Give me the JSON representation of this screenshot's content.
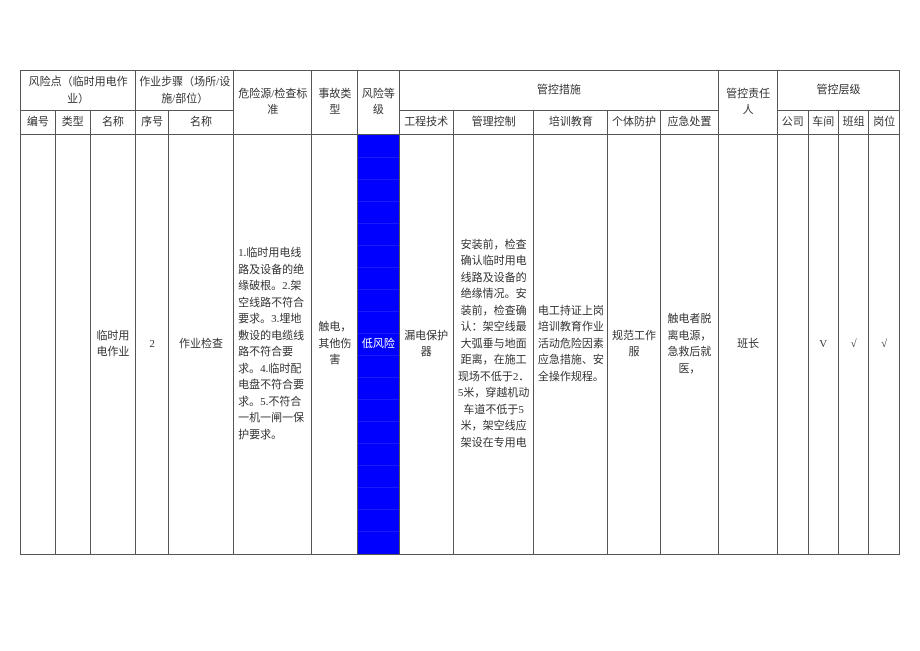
{
  "header": {
    "risk_point": "风险点（临时用电作业）",
    "work_step": "作业步骤（场所/设施/部位）",
    "hazard_source": "危险源/检查标准",
    "accident_type": "事故类型",
    "risk_level": "风险等级",
    "control_measures": "管控措施",
    "control_person": "管控责任人",
    "control_tier": "管控层级",
    "no": "编号",
    "type": "类型",
    "name": "名称",
    "seq": "序号",
    "step_name": "名称",
    "eng_tech": "工程技术",
    "mgmt_ctrl": "管理控制",
    "training": "培训教育",
    "ppe": "个体防护",
    "emergency": "应急处置",
    "company": "公司",
    "workshop": "车间",
    "team": "班组",
    "post": "岗位"
  },
  "row": {
    "no": "",
    "type": "",
    "name": "临时用电作业",
    "seq": "2",
    "step_name": "作业检查",
    "hazard": "1.临时用电线路及设备的绝缘破根。2.架空线路不符合要求。3.埋地敷设的电缆线路不符合要求。4.临时配电盘不符合要求。5.不符合一机一闸一保护要求。",
    "accident": "触电，其他伤害",
    "risk_level": "低风险",
    "eng_tech": "漏电保护器",
    "mgmt_ctrl": "安装前，检查确认临时用电线路及设备的绝缘情况。安装前，检查确认：架空线最大弧垂与地面距离，在施工现场不低于2．5米，穿越机动车道不低于5米，架空线应架设在专用电",
    "training": "电工持证上岗培训教育作业活动危险因素应急措施、安全操作规程。",
    "ppe": "规范工作服",
    "emergency": "触电者脱离电源，急救后就医，",
    "control_person": "班长",
    "company": "",
    "workshop": "V",
    "team": "√",
    "post": "√"
  }
}
